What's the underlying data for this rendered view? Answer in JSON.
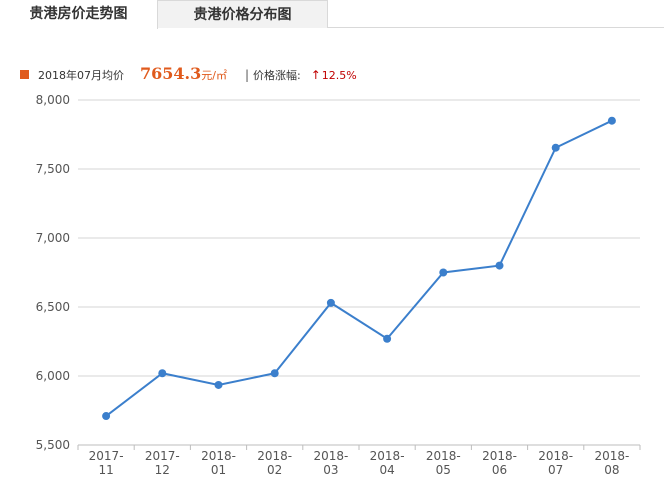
{
  "tabs": [
    {
      "label": "贵港房价走势图",
      "active": true
    },
    {
      "label": "贵港价格分布图",
      "active": false
    }
  ],
  "summary": {
    "period_label": "2018年07月均价",
    "price_value": "7654.3",
    "price_unit": "元/㎡",
    "separator": "|",
    "change_label": "价格涨幅:",
    "change_value": "12.5%",
    "change_direction": "up",
    "arrow_icon": "↑"
  },
  "colors": {
    "accent": "#e05a1c",
    "line": "#3b7fcc",
    "change": "#c00000",
    "grid": "#d6d6d6"
  },
  "chart_data": {
    "type": "line",
    "x": [
      "2017-11",
      "2017-12",
      "2018-01",
      "2018-02",
      "2018-03",
      "2018-04",
      "2018-05",
      "2018-06",
      "2018-07",
      "2018-08"
    ],
    "series": [
      {
        "values": [
          5710,
          6020,
          5935,
          6020,
          6530,
          6270,
          6750,
          6800,
          7654.3,
          7850
        ]
      }
    ],
    "ylim": [
      5500,
      8000
    ],
    "yticks": [
      "8,000",
      "7,500",
      "7,000",
      "6,500",
      "6,000",
      "5,500"
    ],
    "ytick_values": [
      8000,
      7500,
      7000,
      6500,
      6000,
      5500
    ],
    "grid": true
  }
}
